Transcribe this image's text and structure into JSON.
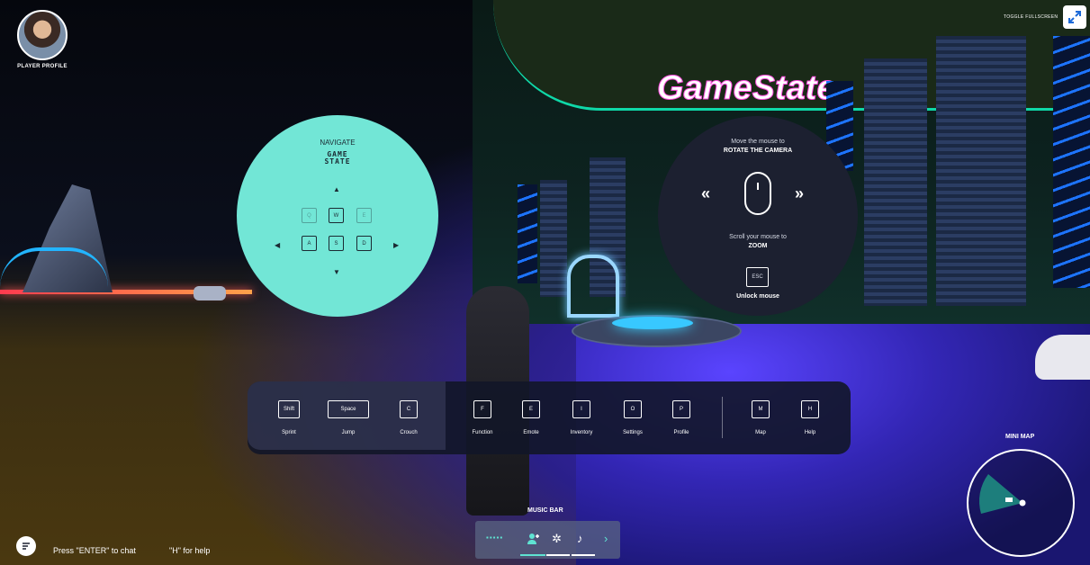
{
  "profile": {
    "label": "PLAYER PROFILE"
  },
  "fullscreen": {
    "label": "TOGGLE FULLSCREEN"
  },
  "scene": {
    "sign_text": "GameState"
  },
  "navigate": {
    "title": "NAVIGATE",
    "logo_line1": "GAME",
    "logo_line2": "STATE",
    "keys": {
      "q": "Q",
      "w": "W",
      "e": "E",
      "a": "A",
      "s": "S",
      "d": "D"
    }
  },
  "camera": {
    "line1": "Move the mouse to",
    "line2": "ROTATE THE CAMERA",
    "line3": "Scroll your mouse to",
    "line4": "ZOOM",
    "esc_key": "ESC",
    "unlock_label": "Unlock mouse"
  },
  "controls": [
    {
      "key": "Shift",
      "label": "Sprint"
    },
    {
      "key": "Space",
      "label": "Jump"
    },
    {
      "key": "C",
      "label": "Crouch"
    },
    {
      "key": "F",
      "label": "Function"
    },
    {
      "key": "E",
      "label": "Emote"
    },
    {
      "key": "I",
      "label": "Inventory"
    },
    {
      "key": "O",
      "label": "Settings"
    },
    {
      "key": "P",
      "label": "Profile"
    },
    {
      "key": "M",
      "label": "Map"
    },
    {
      "key": "H",
      "label": "Help"
    }
  ],
  "music_bar": {
    "label": "MUSIC BAR"
  },
  "chat": {
    "enter_hint": "Press \"ENTER\" to chat",
    "help_hint": "\"H\" for help"
  },
  "minimap": {
    "label": "MINI MAP"
  },
  "icons": {
    "fullscreen": "expand-arrows-icon",
    "chat": "chat-bubble-icon",
    "music": [
      "equalizer-icon",
      "add-user-icon",
      "dancer-icon",
      "music-note-icon",
      "chevron-right-icon"
    ]
  },
  "colors": {
    "accent": "#72e6d6",
    "panel": "#1c2030"
  }
}
